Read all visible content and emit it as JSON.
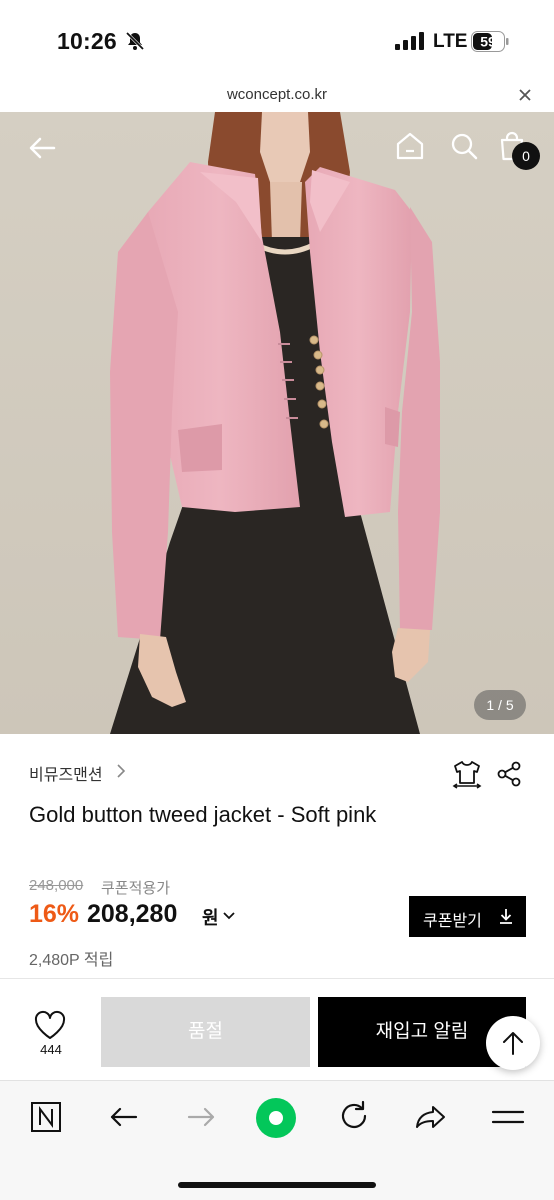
{
  "status_bar": {
    "time": "10:26",
    "network": "LTE",
    "battery": "59"
  },
  "browser": {
    "url": "wconcept.co.kr"
  },
  "header": {
    "cart_count": "0"
  },
  "gallery": {
    "pager": "1 / 5"
  },
  "product": {
    "brand": "비뮤즈맨션",
    "title": "Gold button tweed jacket - Soft pink",
    "original_price": "248,000",
    "coupon_note": "쿠폰적용가",
    "discount": "16%",
    "sale_price": "208,280",
    "currency": "원",
    "coupon_button": "쿠폰받기",
    "points": "2,480P 적립"
  },
  "buy_bar": {
    "like_count": "444",
    "soldout_label": "품절",
    "restock_label": "재입고 알림"
  },
  "colors": {
    "discount": "#ee5a16",
    "primary": "#000000",
    "disabled": "#d9d9d9",
    "naver_green": "#03c75a"
  },
  "icons": {
    "back": "arrow-left-icon",
    "home": "home-icon",
    "search": "search-icon",
    "cart": "shopping-bag-icon",
    "outfit": "outfit-icon",
    "share": "share-icon",
    "like": "heart-icon",
    "coupon_download": "download-icon",
    "scroll_top": "arrow-up-icon"
  }
}
